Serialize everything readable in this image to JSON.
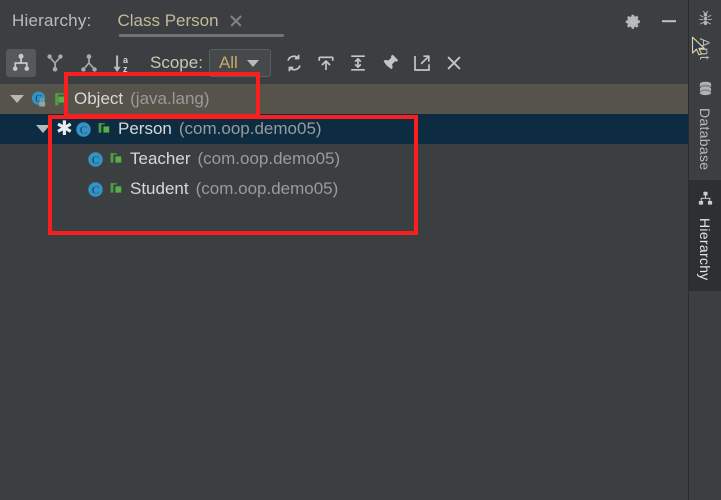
{
  "window": {
    "tool_window_label": "Hierarchy:",
    "settings_icon": "gear-icon",
    "minimize_icon": "minimize-icon"
  },
  "tab": {
    "label": "Class Person",
    "close_icon": "close-icon"
  },
  "toolbar": {
    "buttons": [
      {
        "name": "class-hierarchy-button",
        "icon": "class-hierarchy-icon",
        "selected": true
      },
      {
        "name": "supertypes-hierarchy-button",
        "icon": "supertypes-icon",
        "selected": false
      },
      {
        "name": "subtypes-hierarchy-button",
        "icon": "subtypes-icon",
        "selected": false
      },
      {
        "name": "sort-alphabetically-button",
        "icon": "sort-az-icon",
        "selected": false
      }
    ],
    "scope_label": "Scope:",
    "scope_value": "All",
    "right_buttons": [
      {
        "name": "refresh-button",
        "icon": "refresh-icon"
      },
      {
        "name": "expand-all-button",
        "icon": "export-up-icon"
      },
      {
        "name": "collapse-all-button",
        "icon": "collapse-icon"
      },
      {
        "name": "pin-tab-button",
        "icon": "pin-icon"
      },
      {
        "name": "open-in-new-window-button",
        "icon": "open-external-icon"
      },
      {
        "name": "close-button",
        "icon": "close-icon"
      }
    ]
  },
  "tree": {
    "nodes": [
      {
        "name": "Object",
        "package": "(java.lang)",
        "depth": 0,
        "expanded": true,
        "has_arrow": true,
        "has_star": false,
        "icon": "class-icon",
        "lock": "locked-icon",
        "highlight": "object-row"
      },
      {
        "name": "Person",
        "package": "(com.oop.demo05)",
        "depth": 1,
        "expanded": true,
        "has_arrow": true,
        "has_star": true,
        "icon": "class-icon",
        "lock": "unlocked-icon",
        "highlight": "selected-row"
      },
      {
        "name": "Teacher",
        "package": "(com.oop.demo05)",
        "depth": 2,
        "expanded": false,
        "has_arrow": false,
        "has_star": false,
        "icon": "class-icon",
        "lock": "unlocked-icon",
        "highlight": "none"
      },
      {
        "name": "Student",
        "package": "(com.oop.demo05)",
        "depth": 2,
        "expanded": false,
        "has_arrow": false,
        "has_star": false,
        "icon": "class-icon",
        "lock": "unlocked-icon",
        "highlight": "none"
      }
    ]
  },
  "annotations": [
    {
      "name": "highlight-rect-object-node",
      "color": "#fa1e1e"
    },
    {
      "name": "highlight-rect-class-tree",
      "color": "#fa1e1e"
    }
  ],
  "right_strip": {
    "items": [
      {
        "name": "sidebar-item-ant",
        "label": "Ant",
        "icon": "ant-icon",
        "active": false
      },
      {
        "name": "sidebar-item-database",
        "label": "Database",
        "icon": "database-icon",
        "active": false
      },
      {
        "name": "sidebar-item-hierarchy",
        "label": "Hierarchy",
        "icon": "hierarchy-icon",
        "active": true
      }
    ]
  },
  "colors": {
    "background": "#3c3f41",
    "object_row": "#55534a",
    "selected_row": "#0d2c42",
    "accent_orange": "#c8a96a",
    "annotation_red": "#fa1e1e",
    "class_icon": "#3592c4",
    "lock_green": "#4f9e3f"
  }
}
